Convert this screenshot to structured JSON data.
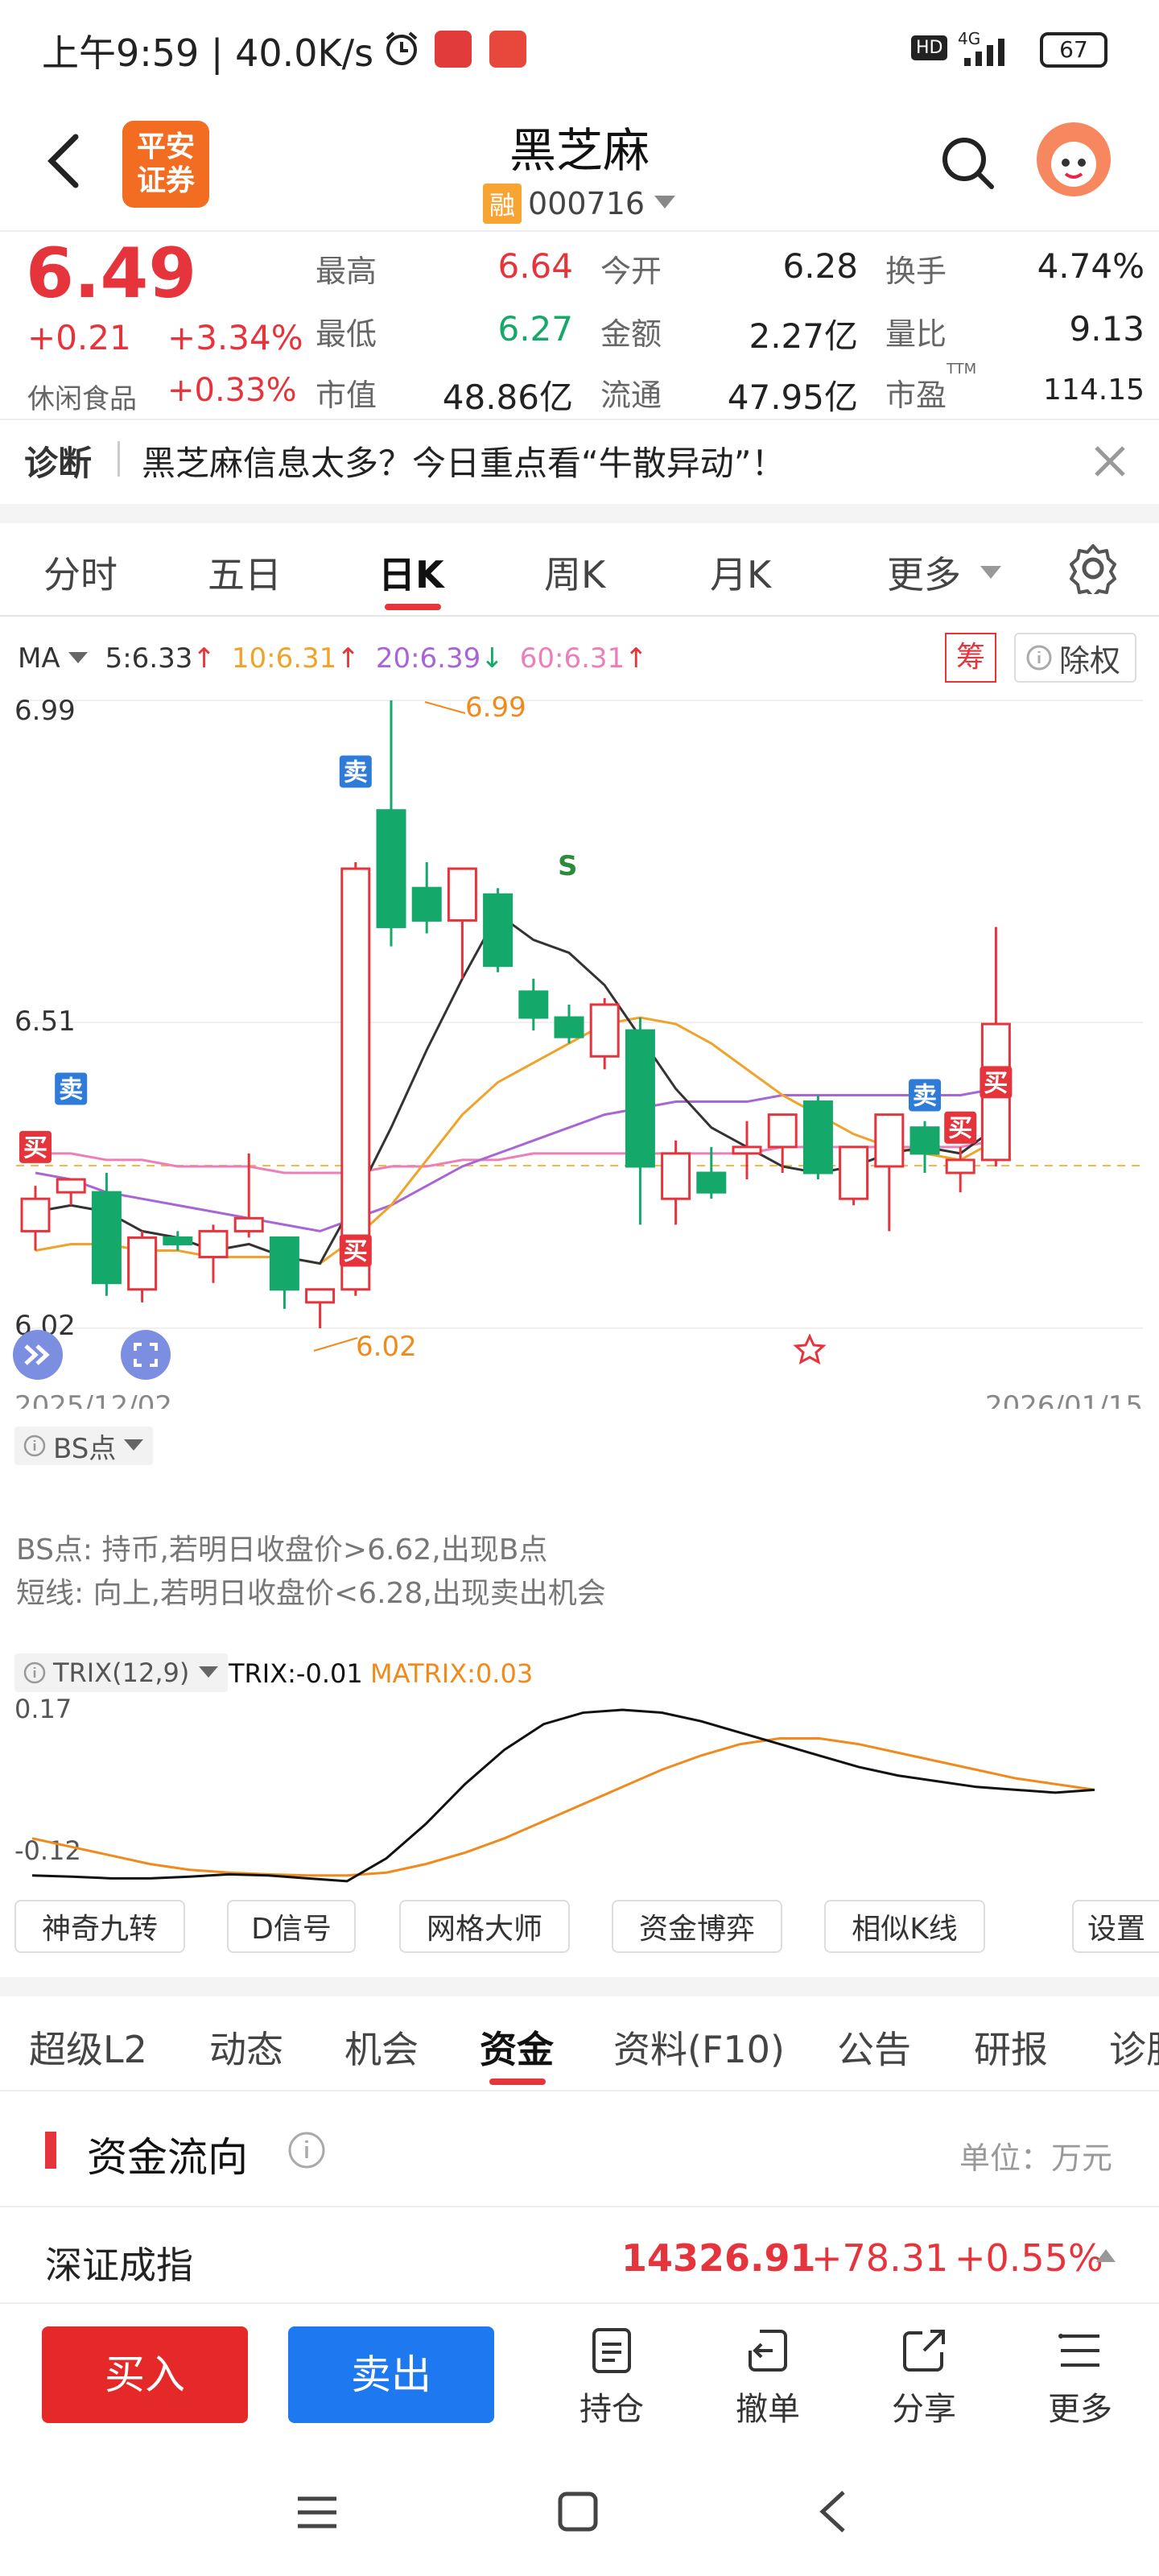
{
  "status_bar": {
    "time": "上午9:59",
    "speed": "40.0K/s",
    "network": "4G",
    "battery": "67",
    "hd": "HD"
  },
  "header": {
    "title": "黑芝麻",
    "badge": "融",
    "code": "000716",
    "logo_line1": "平安",
    "logo_line2": "证券"
  },
  "quote": {
    "price": "6.49",
    "change": "+0.21",
    "change_pct": "+3.34%",
    "sector": "休闲食品",
    "sector_pct": "+0.33%",
    "stats": [
      {
        "label": "最高",
        "value": "6.64",
        "color": "red"
      },
      {
        "label": "今开",
        "value": "6.28",
        "color": "black"
      },
      {
        "label": "换手",
        "value": "4.74%",
        "color": "black"
      },
      {
        "label": "最低",
        "value": "6.27",
        "color": "green"
      },
      {
        "label": "金额",
        "value": "2.27亿",
        "color": "black"
      },
      {
        "label": "量比",
        "value": "9.13",
        "color": "black"
      },
      {
        "label": "市值",
        "value": "48.86亿",
        "color": "black"
      },
      {
        "label": "流通",
        "value": "47.95亿",
        "color": "black"
      },
      {
        "label": "市盈",
        "value": "114.15",
        "color": "black",
        "sup": "TTM"
      }
    ]
  },
  "diagnosis": {
    "label": "诊断",
    "text": "黑芝麻信息太多？今日重点看“牛散异动”！"
  },
  "chart_tabs": [
    "分时",
    "五日",
    "日K",
    "周K",
    "月K",
    "更多"
  ],
  "active_chart_tab": "日K",
  "ma": {
    "label": "MA",
    "ma5": "5:6.33",
    "ma10": "10:6.31",
    "ma20": "20:6.39",
    "ma60": "60:6.31",
    "chou": "筹",
    "fuquan": "除权",
    "colors": {
      "ma5": "#333333",
      "ma10": "#f0a32a",
      "ma20": "#a865d6",
      "ma60": "#ec7fb8",
      "up": "#e5343c",
      "down": "#14a86a"
    }
  },
  "chart_data": {
    "type": "candlestick",
    "y_top_label": "6.99",
    "y_mid_label": "6.51",
    "y_low_label": "6.02",
    "high_marker": "6.99",
    "low_marker": "6.02",
    "date_start": "2025/12/02",
    "date_end": "2026/01/15",
    "ylim": [
      6.02,
      6.99
    ],
    "candles": [
      {
        "o": 6.17,
        "h": 6.24,
        "l": 6.14,
        "c": 6.22
      },
      {
        "o": 6.23,
        "h": 6.25,
        "l": 6.21,
        "c": 6.25
      },
      {
        "o": 6.23,
        "h": 6.26,
        "l": 6.07,
        "c": 6.09
      },
      {
        "o": 6.08,
        "h": 6.17,
        "l": 6.06,
        "c": 6.16
      },
      {
        "o": 6.16,
        "h": 6.17,
        "l": 6.14,
        "c": 6.15
      },
      {
        "o": 6.13,
        "h": 6.18,
        "l": 6.09,
        "c": 6.17
      },
      {
        "o": 6.17,
        "h": 6.29,
        "l": 6.16,
        "c": 6.19
      },
      {
        "o": 6.16,
        "h": 6.16,
        "l": 6.05,
        "c": 6.08
      },
      {
        "o": 6.06,
        "h": 6.08,
        "l": 6.02,
        "c": 6.08
      },
      {
        "o": 6.08,
        "h": 6.74,
        "l": 6.07,
        "c": 6.73
      },
      {
        "o": 6.82,
        "h": 6.99,
        "l": 6.61,
        "c": 6.64
      },
      {
        "o": 6.7,
        "h": 6.74,
        "l": 6.63,
        "c": 6.65
      },
      {
        "o": 6.65,
        "h": 6.73,
        "l": 6.56,
        "c": 6.73
      },
      {
        "o": 6.69,
        "h": 6.7,
        "l": 6.57,
        "c": 6.58
      },
      {
        "o": 6.54,
        "h": 6.56,
        "l": 6.48,
        "c": 6.5
      },
      {
        "o": 6.5,
        "h": 6.52,
        "l": 6.46,
        "c": 6.47
      },
      {
        "o": 6.44,
        "h": 6.53,
        "l": 6.42,
        "c": 6.52
      },
      {
        "o": 6.48,
        "h": 6.5,
        "l": 6.18,
        "c": 6.27
      },
      {
        "o": 6.22,
        "h": 6.31,
        "l": 6.18,
        "c": 6.29
      },
      {
        "o": 6.26,
        "h": 6.3,
        "l": 6.22,
        "c": 6.23
      },
      {
        "o": 6.29,
        "h": 6.34,
        "l": 6.25,
        "c": 6.3
      },
      {
        "o": 6.3,
        "h": 6.35,
        "l": 6.26,
        "c": 6.35
      },
      {
        "o": 6.37,
        "h": 6.38,
        "l": 6.25,
        "c": 6.26
      },
      {
        "o": 6.22,
        "h": 6.3,
        "l": 6.21,
        "c": 6.3
      },
      {
        "o": 6.27,
        "h": 6.35,
        "l": 6.17,
        "c": 6.35
      },
      {
        "o": 6.33,
        "h": 6.34,
        "l": 6.26,
        "c": 6.29
      },
      {
        "o": 6.26,
        "h": 6.3,
        "l": 6.23,
        "c": 6.28
      },
      {
        "o": 6.28,
        "h": 6.64,
        "l": 6.27,
        "c": 6.49
      }
    ],
    "ma5": [
      6.2,
      6.21,
      6.2,
      6.17,
      6.16,
      6.14,
      6.15,
      6.13,
      6.12,
      6.22,
      6.33,
      6.45,
      6.56,
      6.66,
      6.62,
      6.6,
      6.55,
      6.47,
      6.39,
      6.33,
      6.3,
      6.27,
      6.26,
      6.27,
      6.29,
      6.3,
      6.29,
      6.33
    ],
    "ma10": [
      6.14,
      6.15,
      6.15,
      6.14,
      6.14,
      6.13,
      6.13,
      6.13,
      6.12,
      6.16,
      6.21,
      6.28,
      6.35,
      6.4,
      6.43,
      6.46,
      6.49,
      6.5,
      6.49,
      6.46,
      6.42,
      6.38,
      6.35,
      6.32,
      6.3,
      6.29,
      6.28,
      6.31
    ],
    "ma20": [
      6.26,
      6.25,
      6.23,
      6.22,
      6.21,
      6.2,
      6.19,
      6.18,
      6.17,
      6.19,
      6.21,
      6.24,
      6.27,
      6.29,
      6.31,
      6.33,
      6.35,
      6.36,
      6.37,
      6.37,
      6.37,
      6.38,
      6.38,
      6.38,
      6.38,
      6.38,
      6.38,
      6.39
    ],
    "ma60": [
      6.29,
      6.29,
      6.28,
      6.28,
      6.27,
      6.27,
      6.27,
      6.26,
      6.26,
      6.26,
      6.27,
      6.27,
      6.28,
      6.28,
      6.29,
      6.29,
      6.29,
      6.29,
      6.29,
      6.29,
      6.29,
      6.3,
      6.3,
      6.3,
      6.3,
      6.3,
      6.3,
      6.31
    ],
    "trix_label": "TRIX(12,9)",
    "trix_value": "TRIX:-0.01",
    "matrix_value": "MATRIX:0.03",
    "trix_top": "0.17",
    "trix_bottom": "-0.12",
    "trix_ylim": [
      -0.14,
      0.17
    ],
    "trix": [
      -0.12,
      -0.122,
      -0.125,
      -0.125,
      -0.122,
      -0.118,
      -0.12,
      -0.125,
      -0.13,
      -0.09,
      -0.03,
      0.04,
      0.1,
      0.145,
      0.165,
      0.17,
      0.165,
      0.15,
      0.13,
      0.11,
      0.09,
      0.07,
      0.055,
      0.045,
      0.035,
      0.03,
      0.025,
      0.03
    ],
    "matrix": [
      -0.055,
      -0.07,
      -0.085,
      -0.1,
      -0.11,
      -0.115,
      -0.118,
      -0.12,
      -0.12,
      -0.115,
      -0.1,
      -0.08,
      -0.055,
      -0.025,
      0.005,
      0.035,
      0.065,
      0.09,
      0.11,
      0.12,
      0.12,
      0.11,
      0.095,
      0.08,
      0.065,
      0.05,
      0.04,
      0.03
    ]
  },
  "bs": {
    "label": "BS点",
    "line1": "BS点: 持币,若明日收盘价>6.62,出现B点",
    "line2": "短线: 向上,若明日收盘价<6.28,出现卖出机会"
  },
  "tools": [
    "神奇九转",
    "D信号",
    "网格大师",
    "资金博弈",
    "相似K线",
    "设置"
  ],
  "bottom_tabs": [
    "超级L2",
    "动态",
    "机会",
    "资金",
    "资料(F10)",
    "公告",
    "研报",
    "诊股"
  ],
  "active_bottom_tab": "资金",
  "fund": {
    "title": "资金流向",
    "unit": "单位：万元"
  },
  "index": {
    "name": "深证成指",
    "value": "14326.91",
    "change": "+78.31",
    "pct": "+0.55%"
  },
  "actions": {
    "buy": "买入",
    "sell": "卖出",
    "hold": "持仓",
    "cancel": "撤单",
    "share": "分享",
    "more": "更多"
  },
  "signals": {
    "buy": "买",
    "sell": "卖",
    "s": "S"
  }
}
